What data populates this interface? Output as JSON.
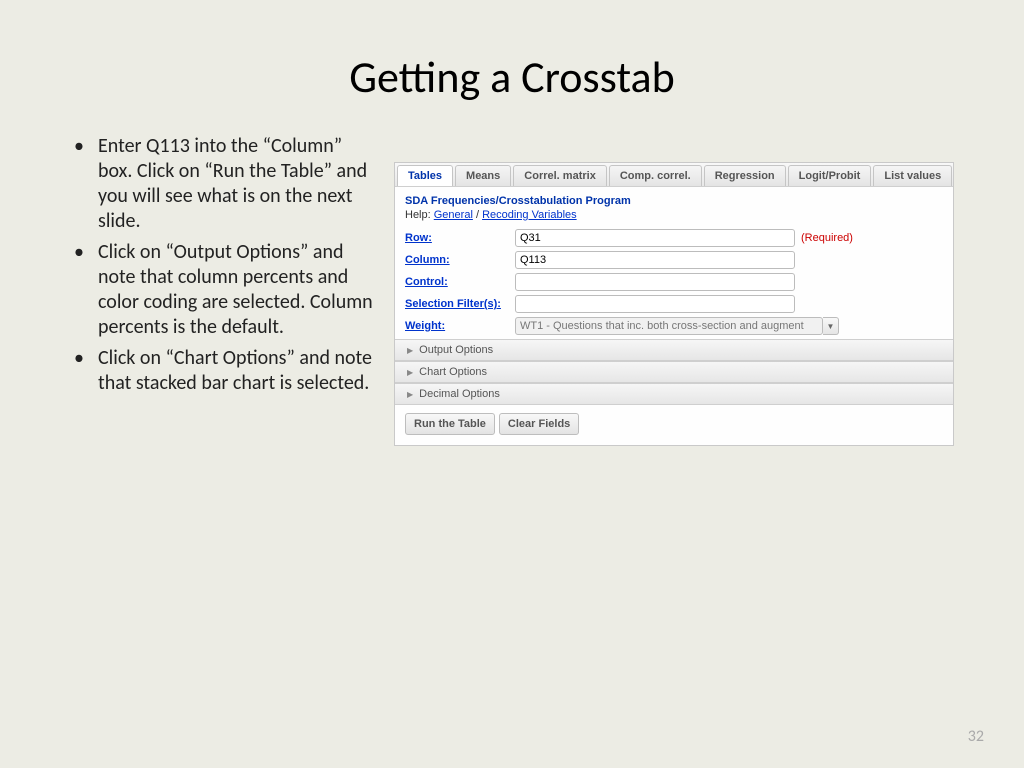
{
  "title": "Getting a Crosstab",
  "bullets": {
    "b1": "Enter Q113 into the “Column” box.  Click on “Run the Table” and you will see what is on the next slide.",
    "b2": "Click on “Output Options” and note that column percents and color coding are selected.  Column percents is the default.",
    "b3": "Click on “Chart Options” and note that stacked bar chart is selected."
  },
  "tabs": {
    "t0": "Tables",
    "t1": "Means",
    "t2": "Correl. matrix",
    "t3": "Comp. correl.",
    "t4": "Regression",
    "t5": "Logit/Probit",
    "t6": "List values"
  },
  "panel": {
    "program": "SDA Frequencies/Crosstabulation Program",
    "help_label": "Help: ",
    "help_general": "General",
    "help_sep": " / ",
    "help_recoding": "Recoding Variables"
  },
  "fields": {
    "row_label": "Row:",
    "row_value": "Q31",
    "required": "(Required)",
    "col_label": "Column:",
    "col_value": "Q113",
    "ctrl_label": "Control:",
    "ctrl_value": "",
    "sel_label": "Selection Filter(s):",
    "sel_value": "",
    "weight_label": "Weight:",
    "weight_value": "WT1 - Questions that inc. both cross-section and augment"
  },
  "accordion": {
    "a0": "Output Options",
    "a1": "Chart Options",
    "a2": "Decimal Options"
  },
  "buttons": {
    "run": "Run the Table",
    "clear": "Clear Fields"
  },
  "page_number": "32"
}
